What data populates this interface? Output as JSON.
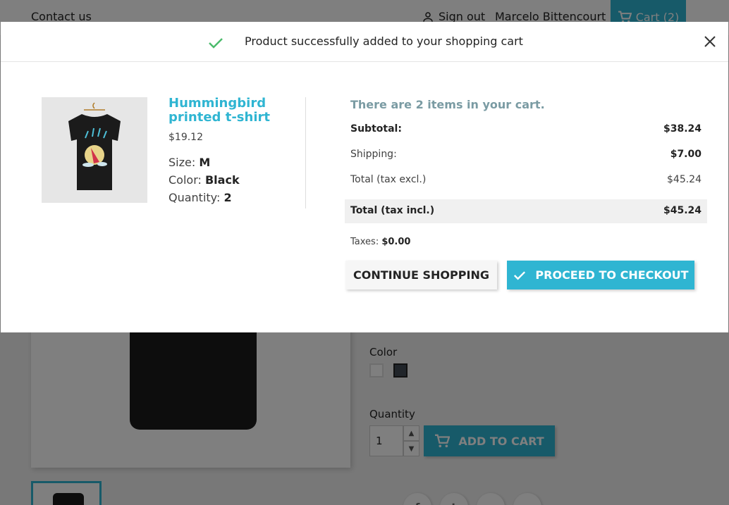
{
  "background": {
    "header": {
      "contact_link": "Contact us",
      "sign_out": "Sign out",
      "user_name": "Marcelo Bittencourt",
      "cart_label": "Cart (2)"
    },
    "product": {
      "color_label": "Color",
      "quantity_label": "Quantity",
      "quantity_value": "1",
      "add_to_cart": "ADD TO CART",
      "swatch_colors": [
        "#ffffff",
        "#434a54"
      ]
    },
    "social_icons": [
      "facebook-icon",
      "twitter-icon",
      "googleplus-icon",
      "pinterest-icon"
    ]
  },
  "modal": {
    "title": "Product successfully added to your shopping cart",
    "product": {
      "name": "Hummingbird printed t-shirt",
      "price": "$19.12",
      "size_label": "Size:",
      "size_value": "M",
      "color_label": "Color:",
      "color_value": "Black",
      "quantity_label": "Quantity:",
      "quantity_value": "2"
    },
    "cart_summary": {
      "count_text": "There are 2 items in your cart.",
      "subtotal_label": "Subtotal:",
      "subtotal_value": "$38.24",
      "shipping_label": "Shipping:",
      "shipping_value": "$7.00",
      "total_excl_label": "Total (tax excl.)",
      "total_excl_value": "$45.24",
      "total_incl_label": "Total (tax incl.)",
      "total_incl_value": "$45.24",
      "taxes_label": "Taxes:",
      "taxes_value": "$0.00"
    },
    "buttons": {
      "continue": "CONTINUE SHOPPING",
      "checkout": "PROCEED TO CHECKOUT"
    }
  },
  "colors": {
    "accent": "#2fb5d2",
    "success_check": "#4cbb6c",
    "cart_count_text": "#7a9ba3"
  }
}
